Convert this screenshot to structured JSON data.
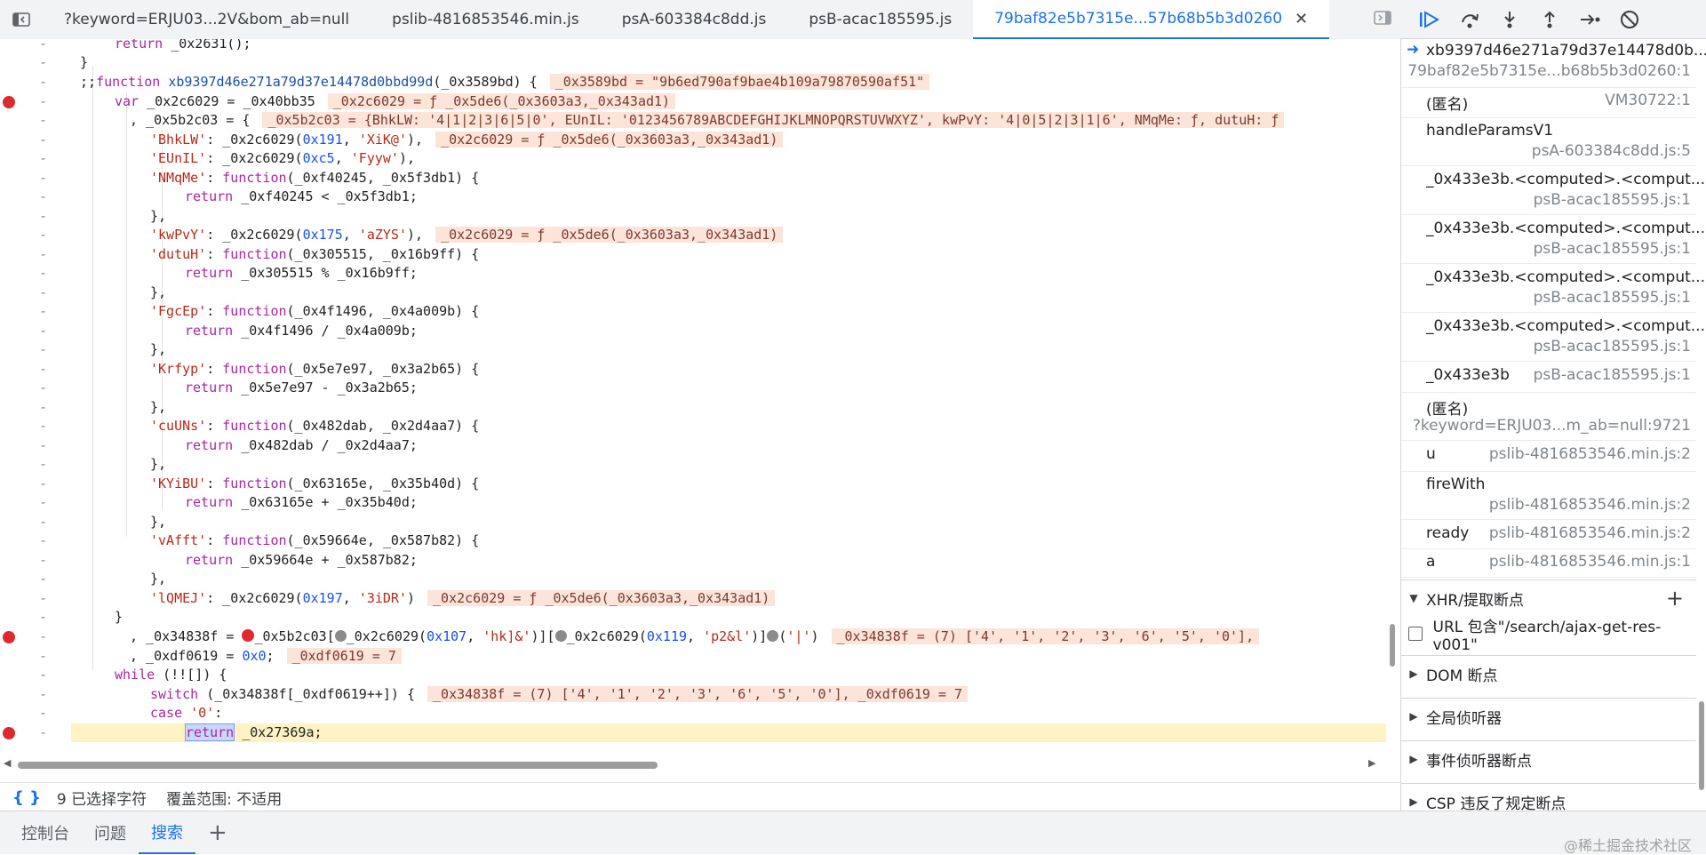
{
  "tabs": [
    {
      "label": "?keyword=ERJU03...2V&bom_ab=null"
    },
    {
      "label": "pslib-4816853546.min.js"
    },
    {
      "label": "psA-603384c8dd.js"
    },
    {
      "label": "psB-acac185595.js"
    },
    {
      "label": "79baf82e5b7315e...57b68b5b3d0260",
      "active": true
    }
  ],
  "icons": {
    "navigator": "sidebar-toggle-icon",
    "close": "close-icon",
    "right_panel": "panel-toggle-icon",
    "resume": "resume-icon",
    "step_over": "step-over-icon",
    "step_into": "step-into-icon",
    "step_out": "step-out-icon",
    "step": "step-icon",
    "deactivate": "deactivate-breakpoints-icon"
  },
  "colors": {
    "accent": "#1a73e8",
    "breakpoint": "#e0292d",
    "current_line": "#fff3c4",
    "inline_value_bg": "#fde4d8"
  },
  "code": {
    "dash": "-",
    "l1": {
      "kw": "return",
      "text": " _0x2631();"
    },
    "l2": {
      "text": "}"
    },
    "l3": {
      "pre": ";;",
      "kw": "function",
      "fn": " xb9397d46e271a79d37e14478d0bbd99d",
      "args": "(_0x3589bd) {",
      "inline": "_0x3589bd = \"9b6ed790af9bae4b109a79870590af51\""
    },
    "l4": {
      "kw": "var",
      "text": " _0x2c6029 = _0x40bb35",
      "inline": "_0x2c6029 = ƒ _0x5de6(_0x3603a3,_0x343ad1)"
    },
    "l5": {
      "text": ", _0x5b2c03 = {",
      "inline": "_0x5b2c03 = {BhkLW: '4|1|2|3|6|5|0', EUnIL: '0123456789ABCDEFGHIJKLMNOPQRSTUVWXYZ', kwPvY: '4|0|5|2|3|1|6', NMqMe: ƒ, dutuH: ƒ"
    },
    "l6": {
      "key": "'BhkLW'",
      "pre": ": _0x2c6029(",
      "num": "0x191",
      "mid": ", ",
      "str": "'XiK@'",
      "post": "),",
      "inline": "_0x2c6029 = ƒ _0x5de6(_0x3603a3,_0x343ad1)"
    },
    "l7": {
      "key": "'EUnIL'",
      "pre": ": _0x2c6029(",
      "num": "0xc5",
      "mid": ", ",
      "str": "'Fyyw'",
      "post": "),"
    },
    "l8": {
      "key": "'NMqMe'",
      "pre": ": ",
      "kw": "function",
      "post": "(_0xf40245, _0x5f3db1) {"
    },
    "l9": {
      "kw": "return",
      "text": " _0xf40245 < _0x5f3db1;"
    },
    "l10": {
      "text": "},"
    },
    "l11": {
      "key": "'kwPvY'",
      "pre": ": _0x2c6029(",
      "num": "0x175",
      "mid": ", ",
      "str": "'aZYS'",
      "post": "),",
      "inline": "_0x2c6029 = ƒ _0x5de6(_0x3603a3,_0x343ad1)"
    },
    "l12": {
      "key": "'dutuH'",
      "pre": ": ",
      "kw": "function",
      "post": "(_0x305515, _0x16b9ff) {"
    },
    "l13": {
      "kw": "return",
      "text": " _0x305515 % _0x16b9ff;"
    },
    "l14": {
      "text": "},"
    },
    "l15": {
      "key": "'FgcEp'",
      "pre": ": ",
      "kw": "function",
      "post": "(_0x4f1496, _0x4a009b) {"
    },
    "l16": {
      "kw": "return",
      "text": " _0x4f1496 / _0x4a009b;"
    },
    "l17": {
      "text": "},"
    },
    "l18": {
      "key": "'Krfyp'",
      "pre": ": ",
      "kw": "function",
      "post": "(_0x5e7e97, _0x3a2b65) {"
    },
    "l19": {
      "kw": "return",
      "text": " _0x5e7e97 - _0x3a2b65;"
    },
    "l20": {
      "text": "},"
    },
    "l21": {
      "key": "'cuUNs'",
      "pre": ": ",
      "kw": "function",
      "post": "(_0x482dab, _0x2d4aa7) {"
    },
    "l22": {
      "kw": "return",
      "text": " _0x482dab / _0x2d4aa7;"
    },
    "l23": {
      "text": "},"
    },
    "l24": {
      "key": "'KYiBU'",
      "pre": ": ",
      "kw": "function",
      "post": "(_0x63165e, _0x35b40d) {"
    },
    "l25": {
      "kw": "return",
      "text": " _0x63165e + _0x35b40d;"
    },
    "l26": {
      "text": "},"
    },
    "l27": {
      "key": "'vAfft'",
      "pre": ": ",
      "kw": "function",
      "post": "(_0x59664e, _0x587b82) {"
    },
    "l28": {
      "kw": "return",
      "text": " _0x59664e + _0x587b82;"
    },
    "l29": {
      "text": "},"
    },
    "l30": {
      "key": "'lQMEJ'",
      "pre": ": _0x2c6029(",
      "num": "0x197",
      "mid": ", ",
      "str": "'3iDR'",
      "post": ")",
      "inline": "_0x2c6029 = ƒ _0x5de6(_0x3603a3,_0x343ad1)"
    },
    "l31": {
      "text": "}"
    },
    "l32": {
      "a": ", _0x34838f = ",
      "b": "_0x5b2c03[",
      "c": "_0x2c6029(",
      "n1": "0x107",
      "d": ", ",
      "s1": "'hk]&'",
      "e": ")][",
      "f": "_0x2c6029(",
      "n2": "0x119",
      "g": ", ",
      "s2": "'p2&l'",
      "h": ")]",
      "i": "(",
      "s3": "'|'",
      "j": ")",
      "inline": "_0x34838f = (7) ['4', '1', '2', '3', '6', '5', '0'],"
    },
    "l33": {
      "text": ", _0xdf0619 = ",
      "num": "0x0",
      "post": ";",
      "inline": "_0xdf0619 = 7"
    },
    "l34": {
      "kw": "while",
      "text": " (!![]) {"
    },
    "l35": {
      "kw": "switch",
      "text": " (_0x34838f[_0xdf0619++]) {",
      "inline": "_0x34838f = (7) ['4', '1', '2', '3', '6', '5', '0'], _0xdf0619 = 7"
    },
    "l36": {
      "kw": "case",
      "text": " ",
      "str": "'0'",
      "post": ":"
    },
    "l37": {
      "kw": "return",
      "text": " _0x27369a;"
    }
  },
  "status": {
    "braces": "{ }",
    "selected": "9 已选择字符",
    "coverage": "覆盖范围: 不适用"
  },
  "drawer": {
    "tabs": [
      "控制台",
      "问题",
      "搜索"
    ],
    "active": "搜索",
    "add": "+"
  },
  "watermark": "@稀土掘金技术社区",
  "callstack": [
    {
      "name": "xb9397d46e271a79d37e14478d0b...",
      "loc": "79baf82e5b7315e...b68b5b3d0260:1",
      "current": true
    },
    {
      "name": "(匿名)",
      "loc": "VM30722:1"
    },
    {
      "name": "handleParamsV1",
      "loc": "psA-603384c8dd.js:5"
    },
    {
      "name": "_0x433e3b.<computed>.<comput...",
      "loc": "psB-acac185595.js:1"
    },
    {
      "name": "_0x433e3b.<computed>.<comput...",
      "loc": "psB-acac185595.js:1"
    },
    {
      "name": "_0x433e3b.<computed>.<comput...",
      "loc": "psB-acac185595.js:1"
    },
    {
      "name": "_0x433e3b.<computed>.<comput...",
      "loc": "psB-acac185595.js:1"
    },
    {
      "name": "_0x433e3b",
      "loc": "psB-acac185595.js:1"
    },
    {
      "name": "(匿名)",
      "loc": "?keyword=ERJU03...m_ab=null:9721"
    },
    {
      "name": "u",
      "loc": "pslib-4816853546.min.js:2"
    },
    {
      "name": "fireWith",
      "loc": "pslib-4816853546.min.js:2"
    },
    {
      "name": "ready",
      "loc": "pslib-4816853546.min.js:2"
    },
    {
      "name": "a",
      "loc": "pslib-4816853546.min.js:1"
    }
  ],
  "sections": {
    "xhr": "XHR/提取断点",
    "xhr_rule": "URL 包含\"/search/ajax-get-res-v001\"",
    "dom": "DOM 断点",
    "global": "全局侦听器",
    "event": "事件侦听器断点",
    "csp": "CSP 违反了规定断点"
  }
}
